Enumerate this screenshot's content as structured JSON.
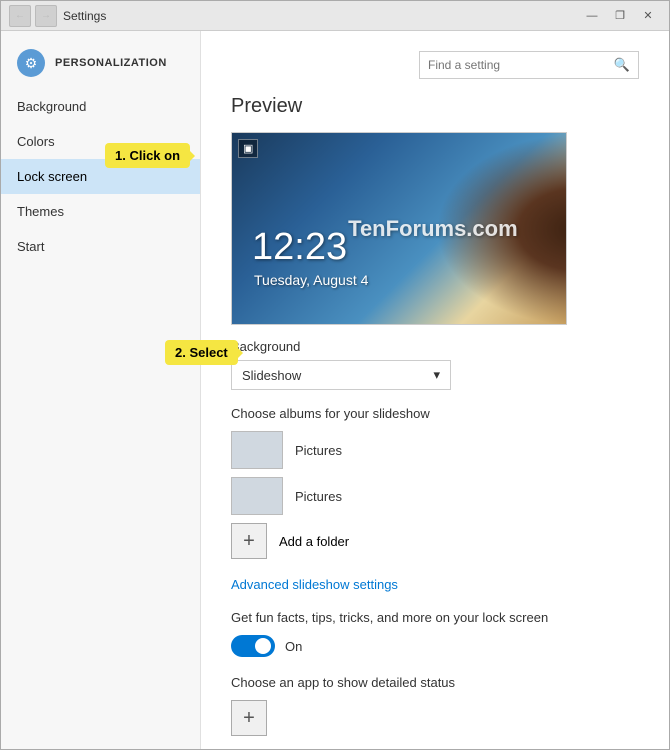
{
  "window": {
    "title": "Settings",
    "nav_back_label": "←",
    "nav_forward_label": "→",
    "btn_minimize": "—",
    "btn_restore": "❐",
    "btn_close": "✕"
  },
  "sidebar": {
    "heading": "PERSONALIZATION",
    "gear_icon": "⚙",
    "items": [
      {
        "id": "background",
        "label": "Background"
      },
      {
        "id": "colors",
        "label": "Colors"
      },
      {
        "id": "lock-screen",
        "label": "Lock screen"
      },
      {
        "id": "themes",
        "label": "Themes"
      },
      {
        "id": "start",
        "label": "Start"
      }
    ]
  },
  "search": {
    "placeholder": "Find a setting",
    "icon": "🔍"
  },
  "content": {
    "preview_title": "Preview",
    "preview_time": "12:23",
    "preview_date": "Tuesday, August 4",
    "preview_watermark": "TenForums.com",
    "background_label": "Background",
    "dropdown_value": "Slideshow",
    "dropdown_arrow": "▾",
    "albums_title": "Choose albums for your slideshow",
    "albums": [
      {
        "name": "Pictures"
      },
      {
        "name": "Pictures"
      }
    ],
    "add_folder_label": "Add a folder",
    "add_folder_icon": "+",
    "advanced_link": "Advanced slideshow settings",
    "fun_facts_label": "Get fun facts, tips, tricks, and more on your lock screen",
    "toggle_on_label": "On",
    "choose_app_label": "Choose an app to show detailed status",
    "plus_icon": "+"
  },
  "callouts": {
    "click_on": "1. Click on",
    "select": "2. Select"
  }
}
